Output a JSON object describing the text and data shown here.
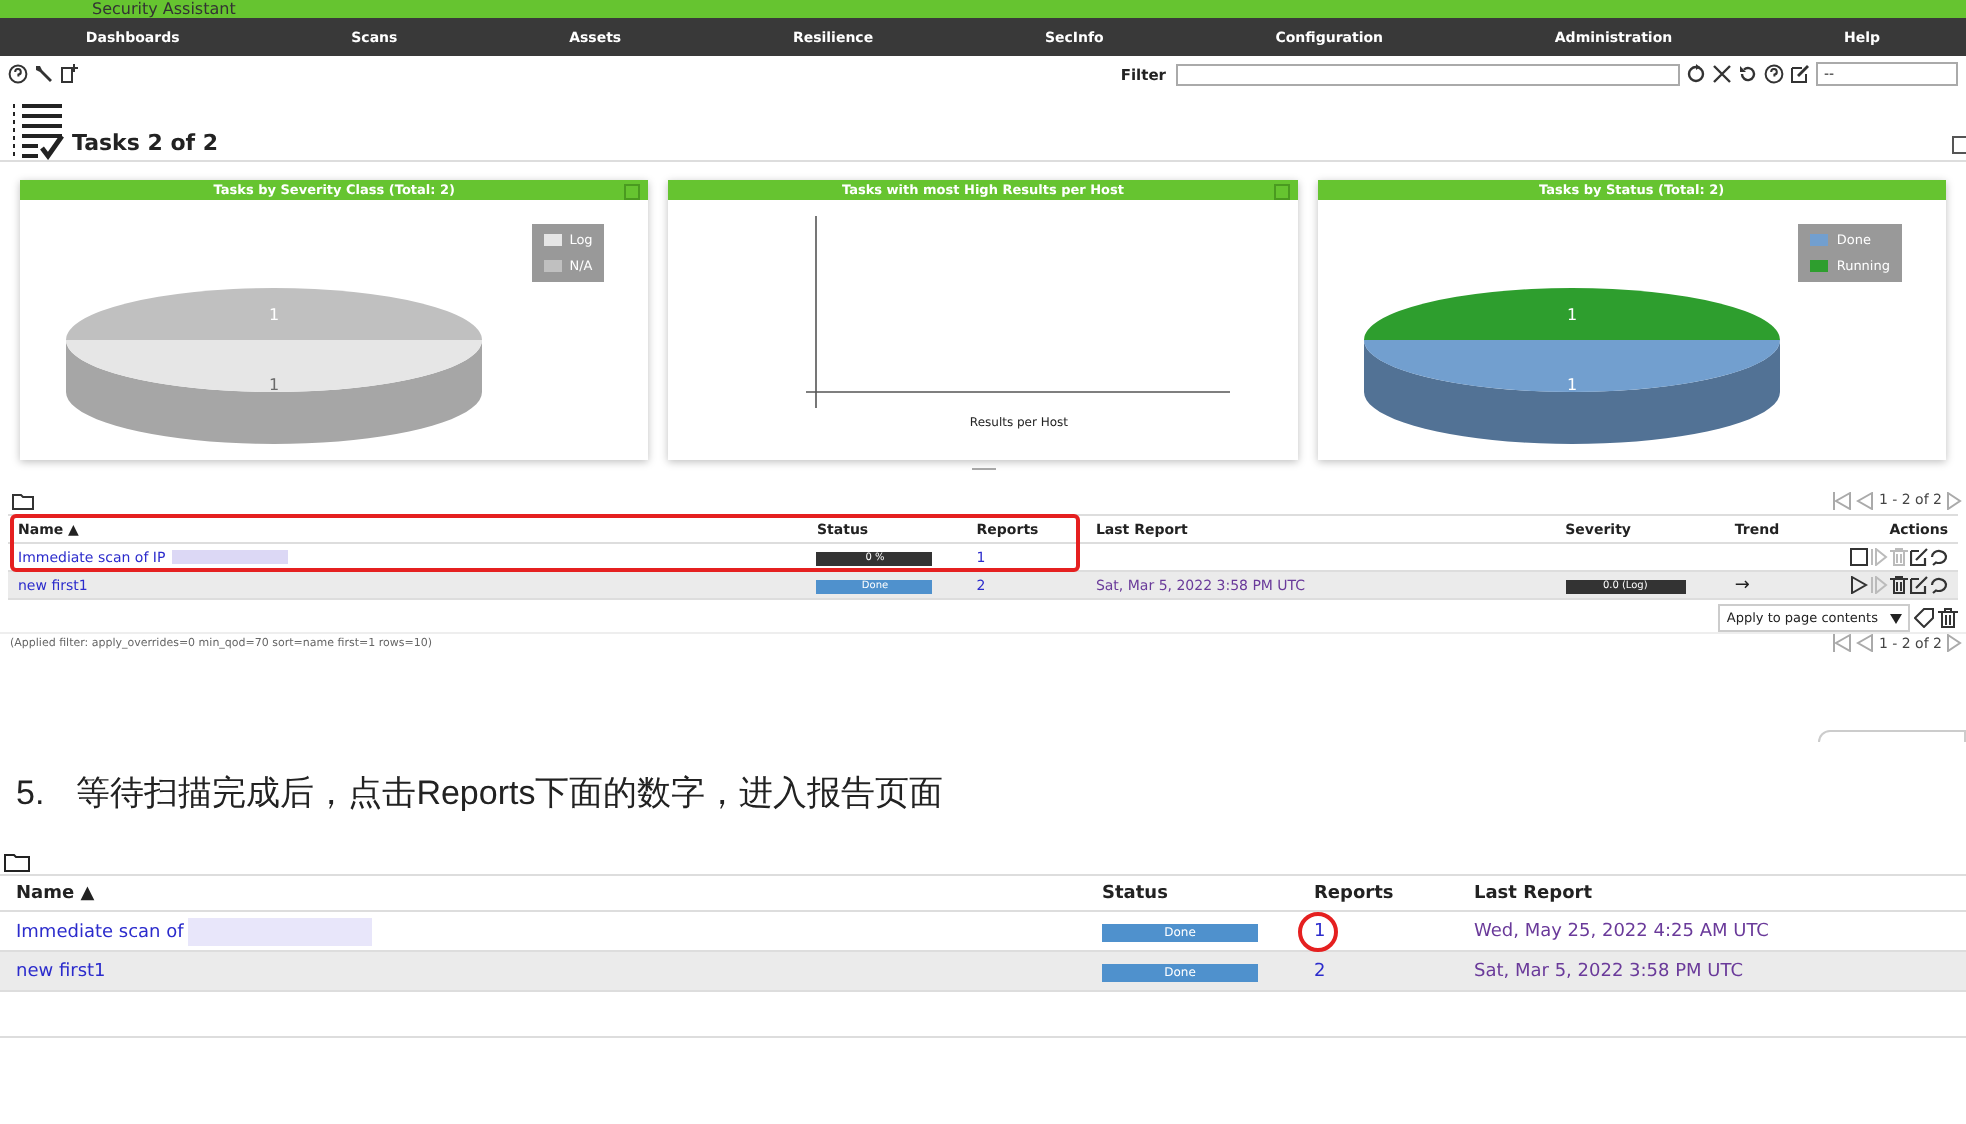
{
  "app": {
    "title": "Security Assistant"
  },
  "nav": [
    "Dashboards",
    "Scans",
    "Assets",
    "Resilience",
    "SecInfo",
    "Configuration",
    "Administration",
    "Help"
  ],
  "filter": {
    "label": "Filter",
    "select": "--"
  },
  "page_title": "Tasks 2 of 2",
  "charts": [
    {
      "kind": "pie",
      "title": "Tasks by Severity Class (Total: 2)",
      "legend": [
        {
          "label": "Log",
          "color": "#e6e6e6"
        },
        {
          "label": "N/A",
          "color": "#c0c0c0"
        }
      ],
      "slice_labels": [
        "1",
        "1"
      ]
    },
    {
      "kind": "empty",
      "title": "Tasks with most High Results per Host",
      "xlabel": "Results per Host"
    },
    {
      "kind": "pie",
      "title": "Tasks by Status (Total: 2)",
      "legend": [
        {
          "label": "Done",
          "color": "#729fcf"
        },
        {
          "label": "Running",
          "color": "#2e9e2e"
        }
      ],
      "slice_labels": [
        "1",
        "1"
      ]
    }
  ],
  "pagination_top": "1 - 2 of 2",
  "pagination_bottom": "1 - 2 of 2",
  "table": {
    "columns": [
      "Name ▲",
      "Status",
      "Reports",
      "Last Report",
      "Severity",
      "Trend",
      "Actions"
    ],
    "rows": [
      {
        "name": "Immediate scan of IP",
        "status": {
          "text": "0 %",
          "kind": "running"
        },
        "reports": "1",
        "last_report": "",
        "severity": "",
        "trend": "",
        "highlighted": true,
        "actions": [
          {
            "kind": "stop",
            "disabled": false
          },
          {
            "kind": "resume",
            "disabled": true
          },
          {
            "kind": "delete",
            "disabled": true
          },
          {
            "kind": "edit",
            "disabled": false
          },
          {
            "kind": "clone",
            "disabled": false
          }
        ]
      },
      {
        "name": "new first1",
        "status": {
          "text": "Done",
          "kind": "done"
        },
        "reports": "2",
        "last_report": "Sat, Mar 5, 2022 3:58 PM UTC",
        "severity": "0.0 (Log)",
        "trend": "→",
        "highlighted": false,
        "actions": [
          {
            "kind": "start",
            "disabled": false
          },
          {
            "kind": "resume",
            "disabled": true
          },
          {
            "kind": "delete",
            "disabled": false
          },
          {
            "kind": "edit",
            "disabled": false
          },
          {
            "kind": "clone",
            "disabled": false
          }
        ]
      }
    ]
  },
  "bulk_action": "Apply to page contents",
  "applied_filter": "(Applied filter: apply_overrides=0 min_qod=70 sort=name first=1 rows=10)",
  "step": {
    "number": "5.",
    "text": "等待扫描完成后，点击Reports下面的数字，进入报告页面"
  },
  "table2": {
    "columns": [
      "Name ▲",
      "Status",
      "Reports",
      "Last Report"
    ],
    "rows": [
      {
        "name": "Immediate scan of",
        "status": {
          "text": "Done",
          "kind": "done"
        },
        "reports": "1",
        "last_report": "Wed, May 25, 2022 4:25 AM UTC",
        "circled": true
      },
      {
        "name": "new first1",
        "status": {
          "text": "Done",
          "kind": "done"
        },
        "reports": "2",
        "last_report": "Sat, Mar 5, 2022 3:58 PM UTC",
        "circled": false
      }
    ]
  }
}
